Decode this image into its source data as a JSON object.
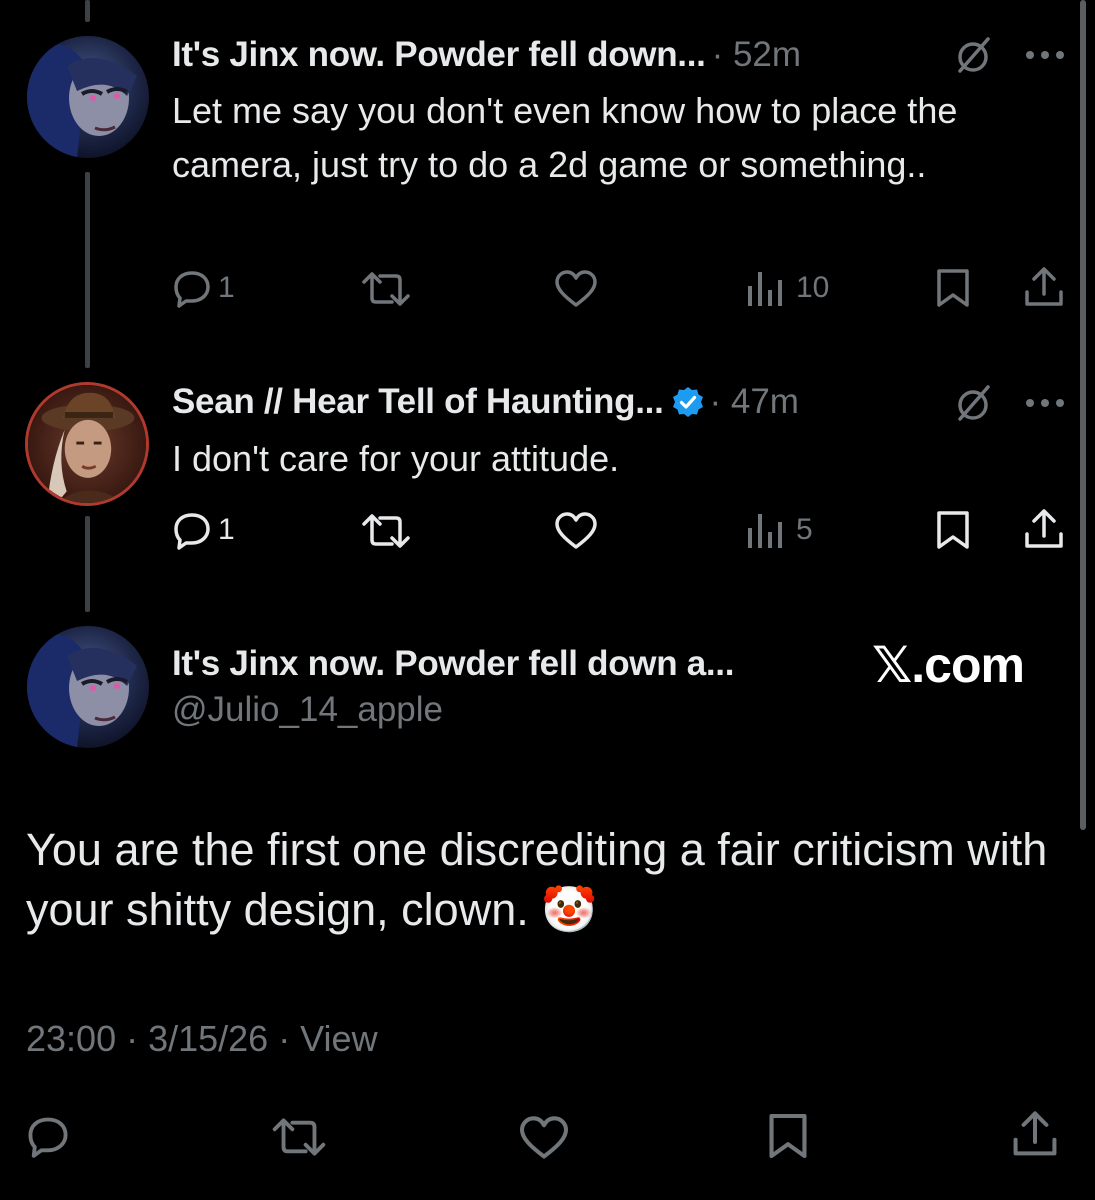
{
  "reply1": {
    "author_name": "It's Jinx now. Powder fell down...",
    "time": "· 52m",
    "text": "Let me say you don't even know how to place the camera, just try to do a 2d game or something..",
    "replies": "1",
    "views": "10",
    "avatar": "jinx-avatar"
  },
  "reply2": {
    "author_name": "Sean // Hear Tell of Haunting...",
    "verified": true,
    "time": "· 47m",
    "text": "I don't care for your attitude.",
    "replies": "1",
    "views": "5",
    "avatar": "cowboy-avatar"
  },
  "main": {
    "author_name": "It's Jinx now. Powder fell down a...",
    "handle": "@Julio_14_apple",
    "text": "You are the first one discrediting a fair criticism with your shitty design, clown.",
    "emoji": "🤡",
    "timestamp": "23:00 · 3/15/26 · View"
  },
  "watermark": "𝕏.com",
  "colors": {
    "background": "#000000",
    "text": "#e7e9ea",
    "muted": "#71767b",
    "verified": "#1d9bf0"
  },
  "icons": [
    "reply-icon",
    "retweet-icon",
    "like-icon",
    "views-icon",
    "bookmark-icon",
    "share-icon",
    "mute-icon",
    "more-icon",
    "verified-badge-icon"
  ]
}
